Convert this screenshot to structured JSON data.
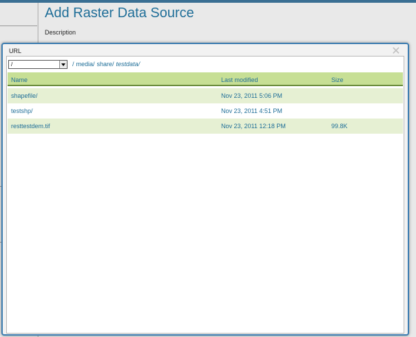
{
  "background": {
    "title": "Add Raster Data Source",
    "description_label": "Description"
  },
  "dialog": {
    "label": "URL",
    "close_icon": "close-icon",
    "root_select_value": "/",
    "breadcrumb": [
      "/",
      "media/",
      "share/",
      "testdata/"
    ],
    "columns": {
      "name": "Name",
      "modified": "Last modified",
      "size": "Size"
    },
    "files": [
      {
        "name": "shapefile/",
        "modified": "Nov 23, 2011 5:06 PM",
        "size": ""
      },
      {
        "name": "testshp/",
        "modified": "Nov 23, 2011 4:51 PM",
        "size": ""
      },
      {
        "name": "resttestdem.tif",
        "modified": "Nov 23, 2011 12:18 PM",
        "size": "99.8K"
      }
    ]
  },
  "colors": {
    "accent": "#1f6e98",
    "header_bg": "#c7df95",
    "alt_row_bg": "#e6f0d3",
    "dialog_border": "#3b7cb0"
  }
}
